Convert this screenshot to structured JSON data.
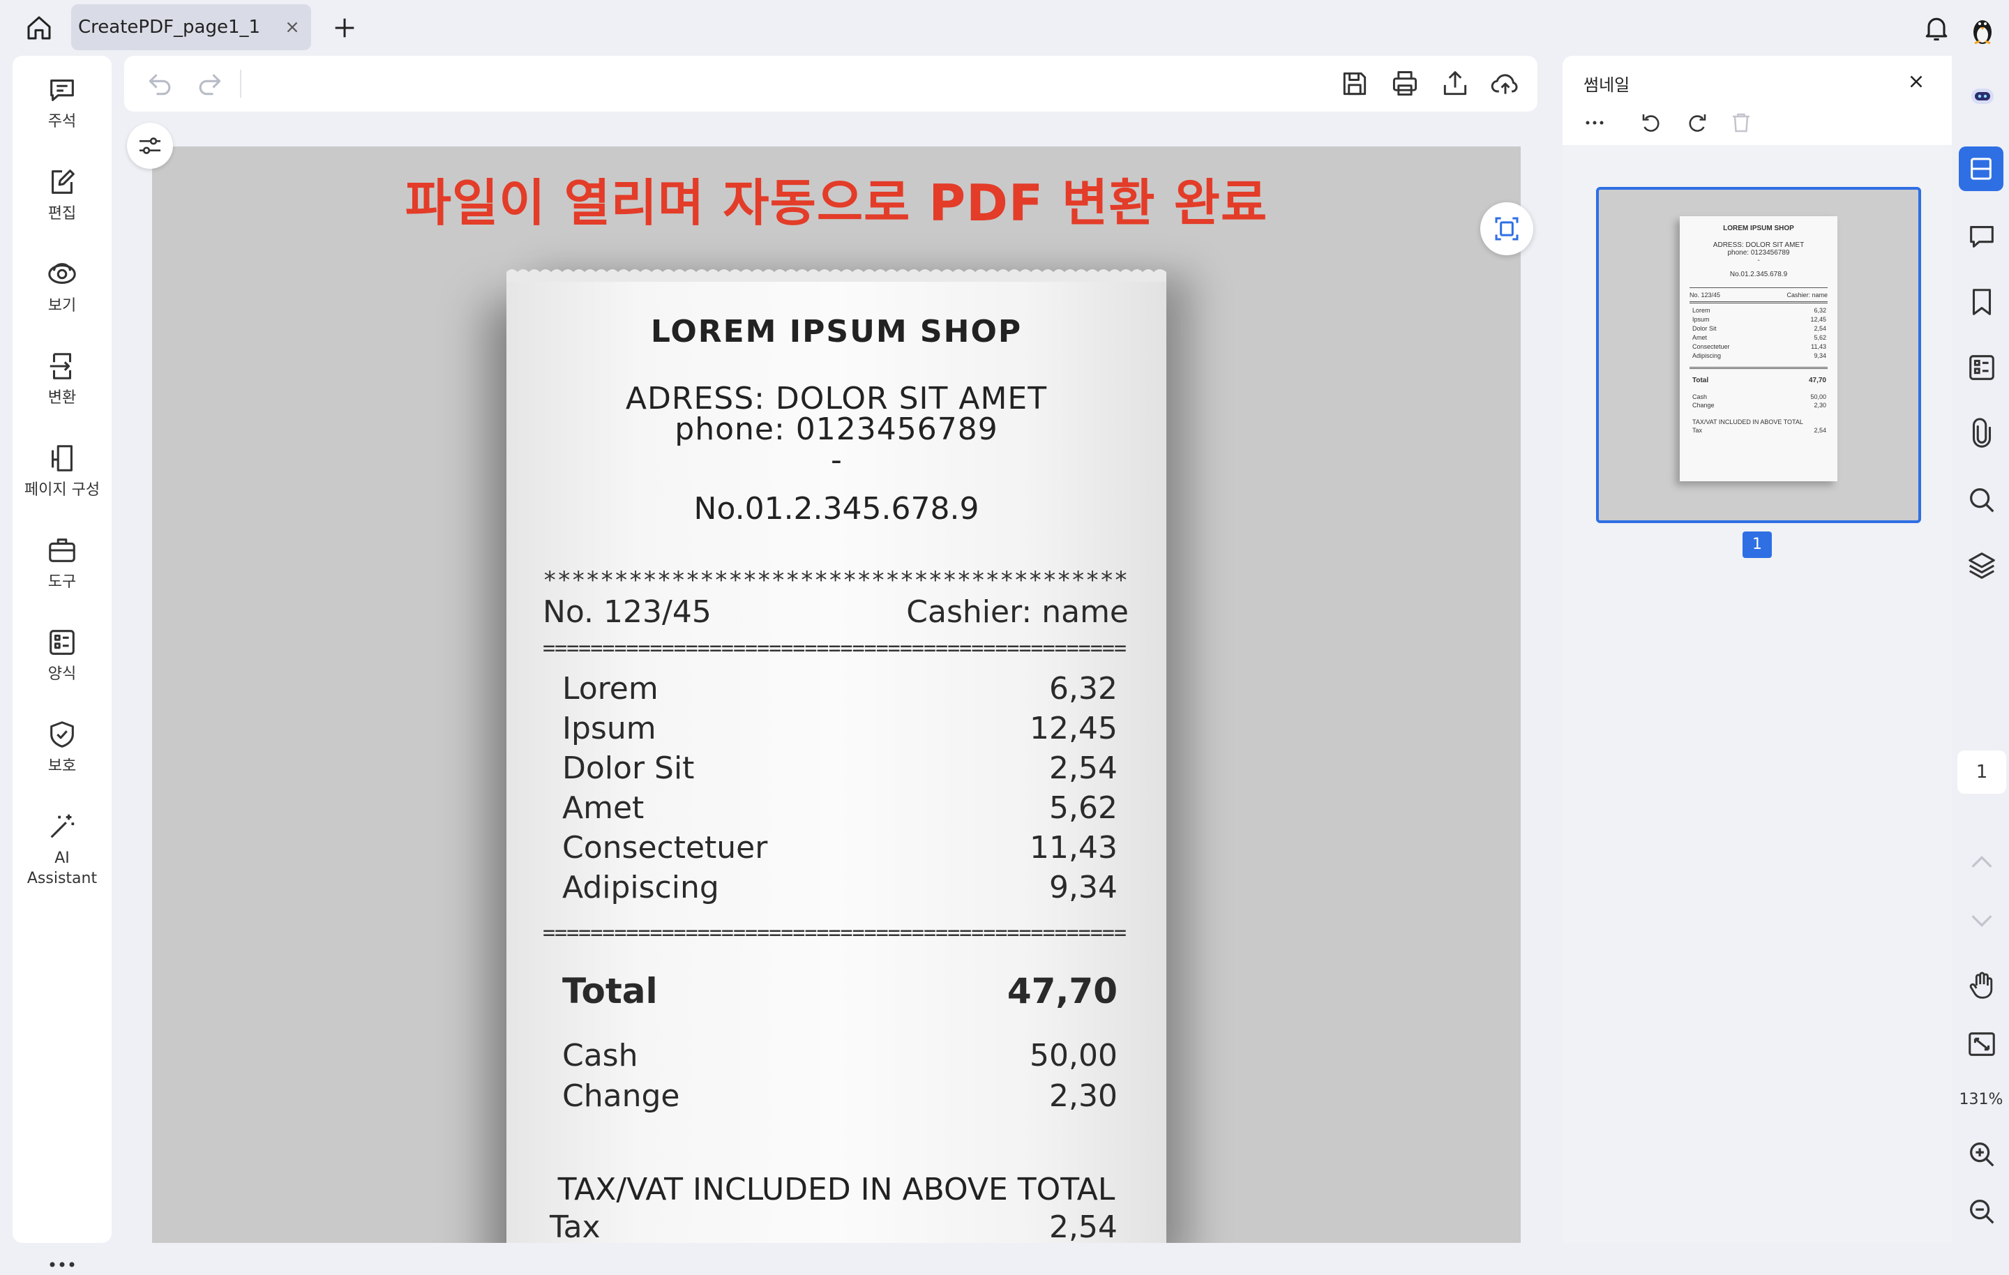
{
  "tab": {
    "title": "CreatePDF_page1_1"
  },
  "left_nav": [
    {
      "key": "annotate",
      "label": "주석",
      "icon": "comment-icon"
    },
    {
      "key": "edit",
      "label": "편집",
      "icon": "edit-icon"
    },
    {
      "key": "view",
      "label": "보기",
      "icon": "eye-icon"
    },
    {
      "key": "convert",
      "label": "변환",
      "icon": "convert-icon"
    },
    {
      "key": "page",
      "label": "페이지 구성",
      "icon": "page-organize-icon"
    },
    {
      "key": "tools",
      "label": "도구",
      "icon": "toolbox-icon"
    },
    {
      "key": "forms",
      "label": "양식",
      "icon": "form-icon"
    },
    {
      "key": "protect",
      "label": "보호",
      "icon": "shield-icon"
    },
    {
      "key": "ai",
      "label": "AI Assistant",
      "icon": "magic-wand-icon"
    }
  ],
  "document": {
    "headline": "파일이 열리며 자동으로 PDF 변환 완료",
    "receipt": {
      "shop": "LOREM IPSUM SHOP",
      "address": "ADRESS: DOLOR SIT AMET",
      "phone": "phone: 0123456789",
      "dash": "-",
      "number": "No.01.2.345.678.9",
      "stars": "**********************************************",
      "receipt_no": "No. 123/45",
      "cashier": "Cashier: name",
      "equals": "=================================================",
      "items": [
        {
          "name": "Lorem",
          "price": "6,32"
        },
        {
          "name": "Ipsum",
          "price": "12,45"
        },
        {
          "name": "Dolor Sit",
          "price": "2,54"
        },
        {
          "name": "Amet",
          "price": "5,62"
        },
        {
          "name": "Consectetuer",
          "price": "11,43"
        },
        {
          "name": "Adipiscing",
          "price": "9,34"
        }
      ],
      "total_label": "Total",
      "total_value": "47,70",
      "cash_label": "Cash",
      "cash_value": "50,00",
      "change_label": "Change",
      "change_value": "2,30",
      "tax_note": "TAX/VAT INCLUDED IN ABOVE TOTAL",
      "tax_label": "Tax",
      "tax_value": "2,54"
    }
  },
  "thumbnail_panel": {
    "title": "썸네일",
    "page_badge": "1"
  },
  "right_strip": {
    "page_indicator": "1",
    "zoom": "131%"
  },
  "colors": {
    "accent": "#2f6fe4",
    "headline": "#e33c28"
  }
}
